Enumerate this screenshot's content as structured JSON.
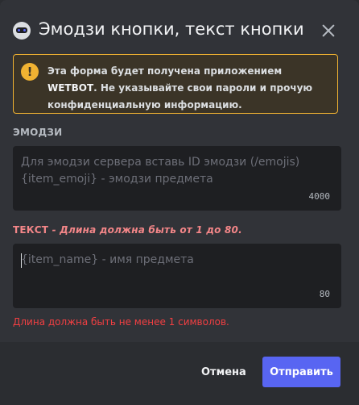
{
  "modal": {
    "title": "Эмодзи кнопки, текст кнопки",
    "app_icon": "bot-avatar-icon",
    "close_icon": "close-icon"
  },
  "warning": {
    "icon": "exclamation-icon",
    "text_before": "Эта форма будет получена приложением ",
    "app_name": "WETBOT",
    "text_after": ". Не указывайте свои пароли и прочую конфиденциальную информацию.",
    "color": "#f0b232"
  },
  "emoji_field": {
    "label": "Эмодзи",
    "placeholder": "Для эмодзи сервера вставь ID эмодзи (/emojis)\n{item_emoji} - эмодзи предмета",
    "value": "",
    "max_length": "4000"
  },
  "text_field": {
    "label": "Текст",
    "hint": " - Длина должна быть от 1 до 80.",
    "placeholder": "{item_name} - имя предмета",
    "value": "",
    "max_length": "80",
    "error": "Длина должна быть не менее 1 символов.",
    "error_color": "#f23f42"
  },
  "footer": {
    "cancel_label": "Отмена",
    "submit_label": "Отправить",
    "submit_color": "#5865f2"
  }
}
